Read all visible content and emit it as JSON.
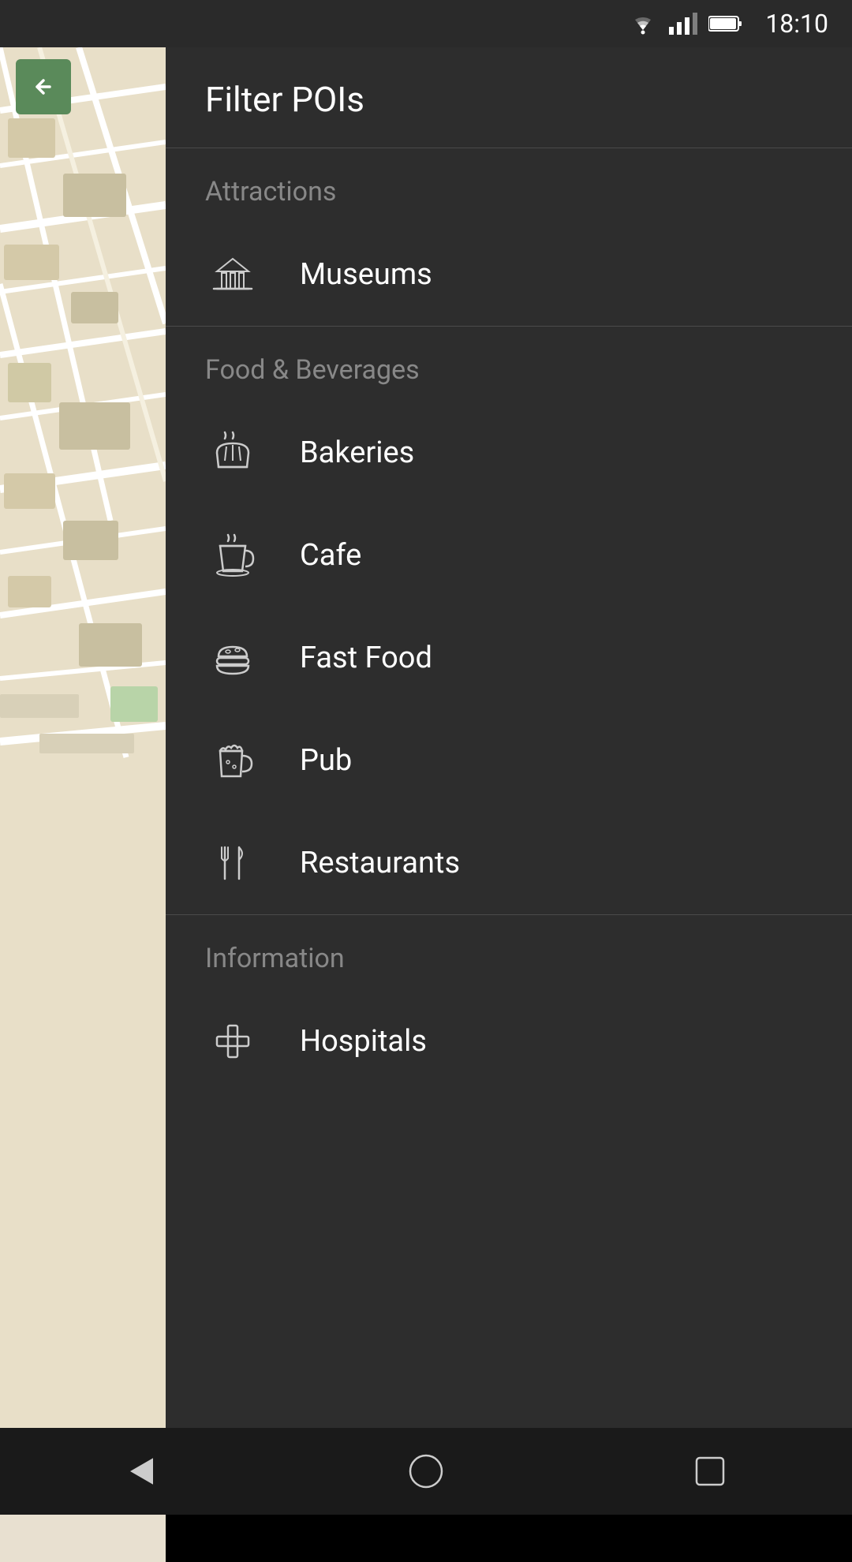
{
  "statusBar": {
    "time": "18:10"
  },
  "backButton": {
    "label": "back"
  },
  "drawer": {
    "title": "Filter POIs",
    "sections": [
      {
        "id": "attractions",
        "title": "Attractions",
        "items": [
          {
            "id": "museums",
            "label": "Museums",
            "icon": "museum"
          }
        ]
      },
      {
        "id": "food-beverages",
        "title": "Food & Beverages",
        "items": [
          {
            "id": "bakeries",
            "label": "Bakeries",
            "icon": "bakery"
          },
          {
            "id": "cafe",
            "label": "Cafe",
            "icon": "cafe"
          },
          {
            "id": "fast-food",
            "label": "Fast Food",
            "icon": "fast-food"
          },
          {
            "id": "pub",
            "label": "Pub",
            "icon": "pub"
          },
          {
            "id": "restaurants",
            "label": "Restaurants",
            "icon": "restaurants"
          }
        ]
      },
      {
        "id": "information",
        "title": "Information",
        "items": [
          {
            "id": "hospitals",
            "label": "Hospitals",
            "icon": "hospital"
          }
        ]
      }
    ]
  },
  "navBar": {
    "back": "back",
    "home": "home",
    "recent": "recent"
  }
}
